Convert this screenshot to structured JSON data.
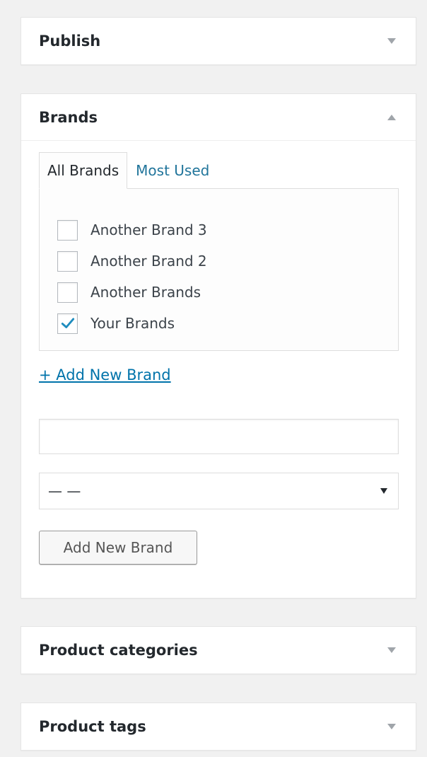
{
  "publish": {
    "title": "Publish"
  },
  "brands": {
    "title": "Brands",
    "tabs": [
      {
        "label": "All Brands",
        "active": true
      },
      {
        "label": "Most Used",
        "active": false
      }
    ],
    "items": [
      {
        "label": "Another Brand 3",
        "checked": false
      },
      {
        "label": "Another Brand 2",
        "checked": false
      },
      {
        "label": "Another Brands",
        "checked": false
      },
      {
        "label": "Your Brands",
        "checked": true
      }
    ],
    "add_link": "+ Add New Brand",
    "new_brand_input": {
      "value": "",
      "placeholder": ""
    },
    "parent_select": {
      "selected": "— —"
    },
    "add_button": "Add New Brand"
  },
  "product_categories": {
    "title": "Product categories"
  },
  "product_tags": {
    "title": "Product tags"
  },
  "colors": {
    "link": "#21759b",
    "check": "#1e8cbe",
    "toggle_arrow": "#a0a5aa"
  }
}
